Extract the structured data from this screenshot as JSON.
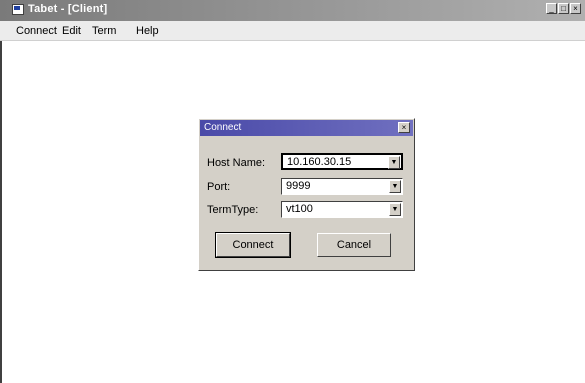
{
  "window": {
    "title": "Tabet - [Client]",
    "minimize": "_",
    "maximize": "□",
    "close": "×"
  },
  "menubar": {
    "items": [
      {
        "label": "Connect"
      },
      {
        "label": "Edit"
      },
      {
        "label": "Term"
      },
      {
        "label": "Help"
      }
    ]
  },
  "dialog": {
    "title": "Connect",
    "close": "×",
    "fields": [
      {
        "label": "Host Name:",
        "value": "10.160.30.15"
      },
      {
        "label": "Port:",
        "value": "9999"
      },
      {
        "label": "TermType:",
        "value": "vt100"
      }
    ],
    "buttons": {
      "connect": "Connect",
      "cancel": "Cancel"
    }
  }
}
